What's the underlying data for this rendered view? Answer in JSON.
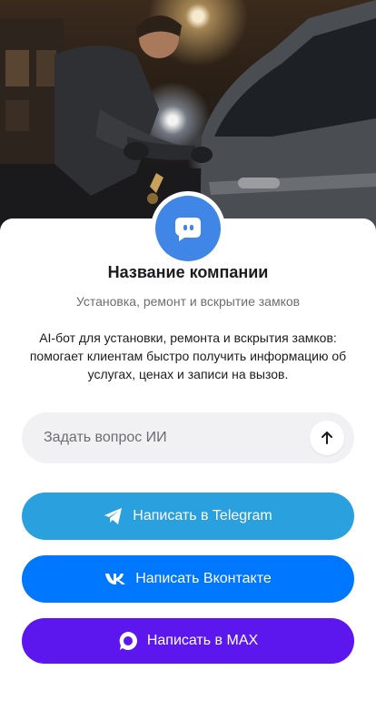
{
  "hero": {
    "image": "locksmith-opening-car-door-photo"
  },
  "company": {
    "avatar_icon": "chat-bot-icon",
    "name": "Название компании",
    "subtitle": "Установка, ремонт и вскрытие замков",
    "description": "AI-бот для установки, ремонта и вскрытия замков: помогает клиентам быстро получить информацию об услугах, ценах и записи на вызов."
  },
  "ask": {
    "placeholder": "Задать вопрос ИИ",
    "send_icon": "arrow-up-icon"
  },
  "buttons": {
    "telegram": {
      "label": "Написать в Telegram",
      "icon": "telegram-icon",
      "color": "#2aa1de"
    },
    "vk": {
      "label": "Написать Вконтакте",
      "icon": "vk-icon",
      "color": "#0077ff"
    },
    "max": {
      "label": "Написать в MAX",
      "icon": "max-icon",
      "color": "#5b17ee"
    }
  },
  "colors": {
    "avatar": "#3f86e6",
    "ask_bg": "#f1f1f3"
  }
}
